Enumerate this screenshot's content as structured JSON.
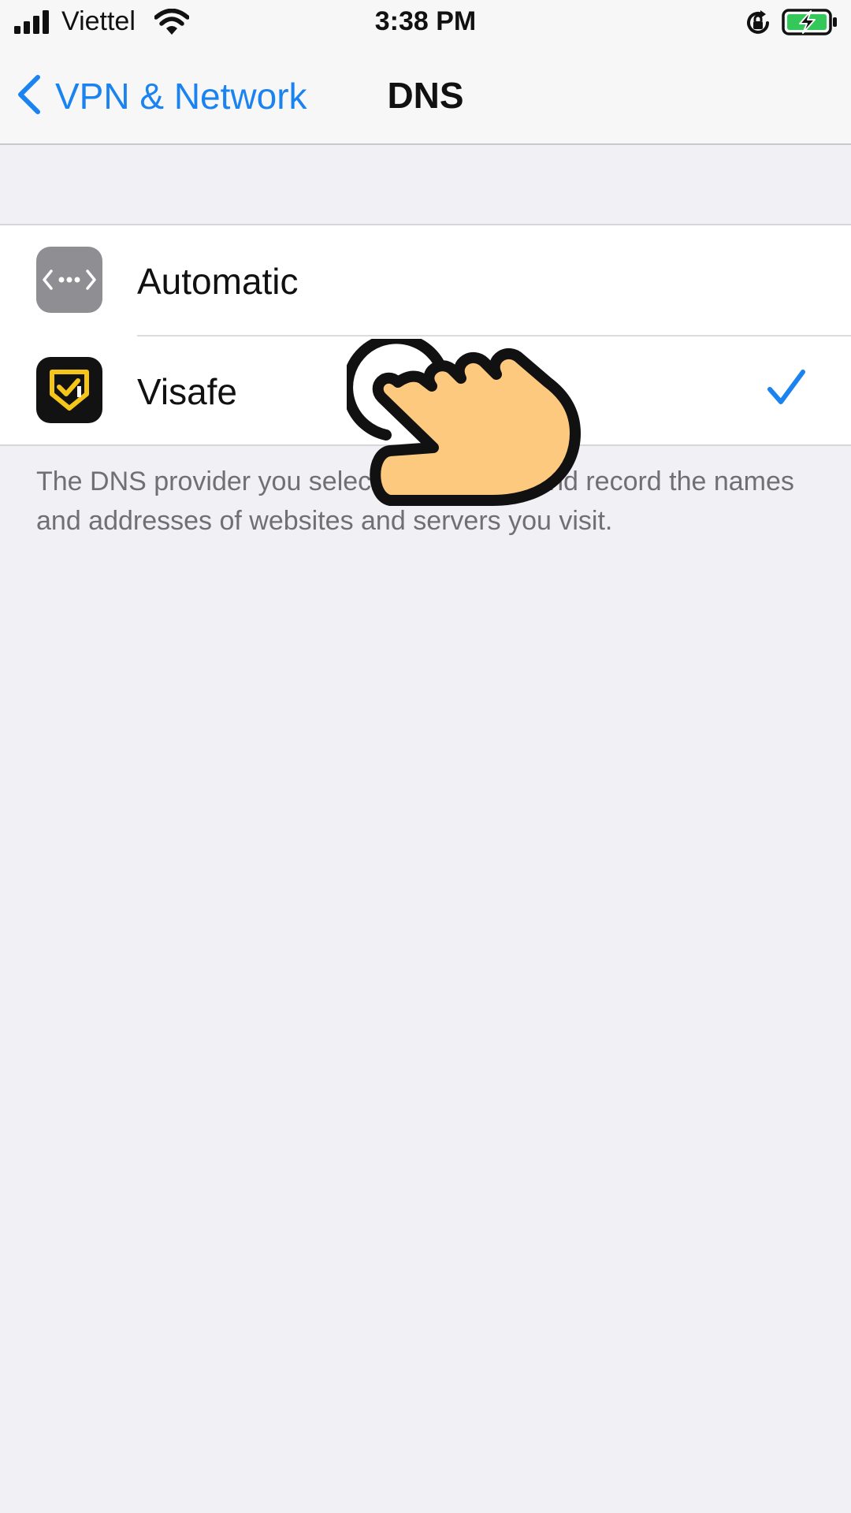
{
  "status_bar": {
    "carrier": "Viettel",
    "time": "3:38 PM",
    "icons": [
      "signal-bars-icon",
      "wifi-icon",
      "rotation-lock-icon",
      "battery-charging-icon"
    ]
  },
  "nav": {
    "back_label": "VPN & Network",
    "title": "DNS"
  },
  "dns_options": [
    {
      "label": "Automatic",
      "icon": "network-dots-icon",
      "selected": false
    },
    {
      "label": "Visafe",
      "icon": "visafe-shield-icon",
      "selected": true
    }
  ],
  "footer_note": "The DNS provider you select can monitor and record the names and addresses of websites and servers you visit.",
  "colors": {
    "accent": "#1a83f0",
    "background": "#f0f0f5",
    "battery_green": "#34c759",
    "visafe_yellow": "#f5c518"
  }
}
